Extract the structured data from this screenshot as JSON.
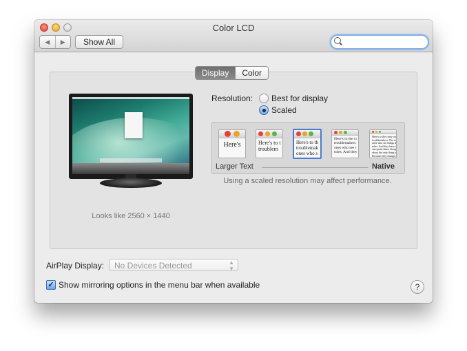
{
  "window": {
    "title": "Color LCD"
  },
  "toolbar": {
    "back_icon": "◀",
    "forward_icon": "▶",
    "show_all_label": "Show All",
    "search_value": ""
  },
  "tabs": [
    {
      "label": "Display",
      "active": true
    },
    {
      "label": "Color",
      "active": false
    }
  ],
  "display": {
    "looks_like": "Looks like 2560 × 1440",
    "resolution_label": "Resolution:",
    "options": [
      {
        "label": "Best for display",
        "selected": false
      },
      {
        "label": "Scaled",
        "selected": true
      }
    ],
    "scale_thumbnails": [
      {
        "text": "Here's",
        "selected": false
      },
      {
        "text": "Here's to t\ntroublem",
        "selected": false
      },
      {
        "text": "Here's to th\ntroublemak\nones who s",
        "selected": true
      },
      {
        "text": "Here's to the cr\ntroublemakers\nones who see t\nrules. And they",
        "selected": false
      },
      {
        "text": "Here's to the crazy one\ntroublemakers. The rou\nones who see things di\nrules. And they have no\ncan quote them, disagre\nabout the only thing you\nBecause they change th",
        "selected": false
      }
    ],
    "scale_left_label": "Larger Text",
    "scale_right_label": "Native",
    "performance_note": "Using a scaled resolution may affect performance."
  },
  "airplay": {
    "label": "AirPlay Display:",
    "value": "No Devices Detected"
  },
  "mirroring": {
    "label": "Show mirroring options in the menu bar when available",
    "checked": true
  },
  "help_label": "?",
  "colors": {
    "accent": "#4a7bd1",
    "close": "#e0443a",
    "minimize": "#e8a528",
    "zoom": "#cfcfcf"
  }
}
